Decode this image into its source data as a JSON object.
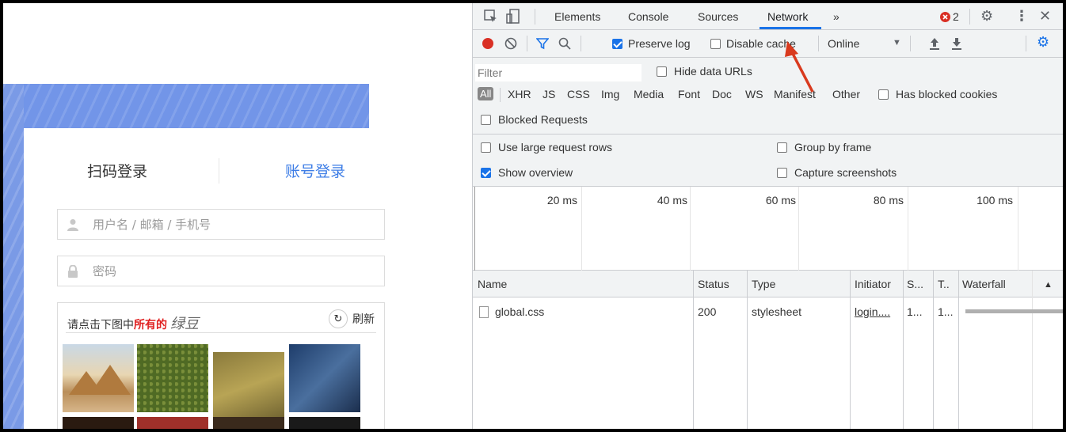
{
  "login": {
    "tabs": {
      "qr_login": "扫码登录",
      "account_login": "账号登录"
    },
    "username_placeholder": "用户名 / 邮箱 / 手机号",
    "password_placeholder": "密码",
    "captcha": {
      "prompt_prefix": "请点击下图中",
      "prompt_highlight": "所有的",
      "prompt_word": "绿豆",
      "refresh_label": "刷新",
      "refresh_icon": "refresh-icon"
    },
    "colors": {
      "accent": "#3d7de6",
      "banner": "#7295e8",
      "highlight": "#e02020"
    }
  },
  "devtools": {
    "tabs": [
      "Elements",
      "Console",
      "Sources",
      "Network"
    ],
    "active_tab": "Network",
    "more_tabs": "»",
    "error_count": "2",
    "toolbar": {
      "preserve_log": "Preserve log",
      "disable_cache": "Disable cache",
      "throttling": "Online",
      "preserve_log_checked": true,
      "disable_cache_checked": false
    },
    "filter": {
      "placeholder": "Filter",
      "hide_data_urls": "Hide data URLs",
      "types": [
        "All",
        "XHR",
        "JS",
        "CSS",
        "Img",
        "Media",
        "Font",
        "Doc",
        "WS",
        "Manifest",
        "Other"
      ],
      "has_blocked_cookies": "Has blocked cookies",
      "blocked_requests": "Blocked Requests"
    },
    "settings": {
      "use_large_rows": "Use large request rows",
      "group_by_frame": "Group by frame",
      "show_overview": "Show overview",
      "capture_screenshots": "Capture screenshots",
      "show_overview_checked": true
    },
    "overview_ticks": [
      "20 ms",
      "40 ms",
      "60 ms",
      "80 ms",
      "100 ms"
    ],
    "table": {
      "columns": [
        "Name",
        "Status",
        "Type",
        "Initiator",
        "S...",
        "T..",
        "Waterfall"
      ],
      "sort_indicator": "▲",
      "rows": [
        {
          "name": "global.css",
          "status": "200",
          "type": "stylesheet",
          "initiator": "login....",
          "size": "1...",
          "time": "1..."
        }
      ]
    },
    "colors": {
      "accent": "#1a73e8",
      "record": "#d93025",
      "annotation_arrow": "#d93a1e"
    }
  }
}
